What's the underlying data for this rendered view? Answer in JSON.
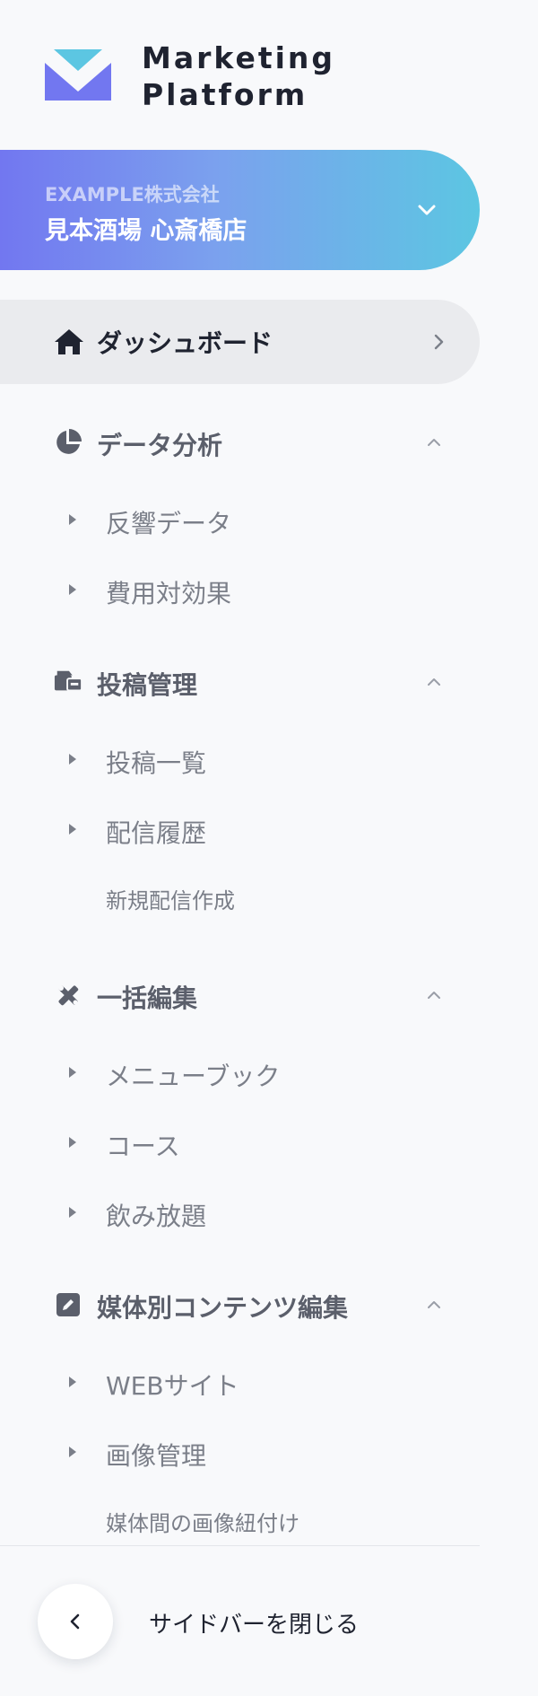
{
  "app": {
    "logo_line1": "Marketing",
    "logo_line2": "Platform",
    "logo_icon": "chevron-v-logo",
    "brand_colors": {
      "gradient_start": "#7277f0",
      "gradient_end": "#5cc6e2",
      "logo_top": "#5cc6e2",
      "logo_bottom": "#7277f0"
    }
  },
  "store": {
    "company": "EXAMPLE株式会社",
    "name": "見本酒場 心斎橋店",
    "icon": "chevron-down-icon"
  },
  "nav": {
    "dashboard": {
      "label": "ダッシュボード",
      "icon": "home-icon",
      "active": true
    },
    "sections": [
      {
        "label": "データ分析",
        "icon": "pie-chart-icon",
        "expanded": true,
        "items": [
          {
            "label": "反響データ"
          },
          {
            "label": "費用対効果"
          }
        ]
      },
      {
        "label": "投稿管理",
        "icon": "post-management-icon",
        "expanded": true,
        "items": [
          {
            "label": "投稿一覧"
          },
          {
            "label": "配信履歴"
          },
          {
            "label": "新規配信作成"
          }
        ]
      },
      {
        "label": "一括編集",
        "icon": "edit-tools-icon",
        "expanded": true,
        "items": [
          {
            "label": "メニューブック"
          },
          {
            "label": "コース"
          },
          {
            "label": "飲み放題"
          }
        ]
      },
      {
        "label": "媒体別コンテンツ編集",
        "icon": "edit-square-icon",
        "expanded": true,
        "items": [
          {
            "label": "WEBサイト"
          },
          {
            "label": "画像管理"
          },
          {
            "label": "媒体間の画像紐付け"
          }
        ]
      }
    ]
  },
  "footer": {
    "close_label": "サイドバーを閉じる",
    "close_icon": "chevron-left-icon"
  }
}
